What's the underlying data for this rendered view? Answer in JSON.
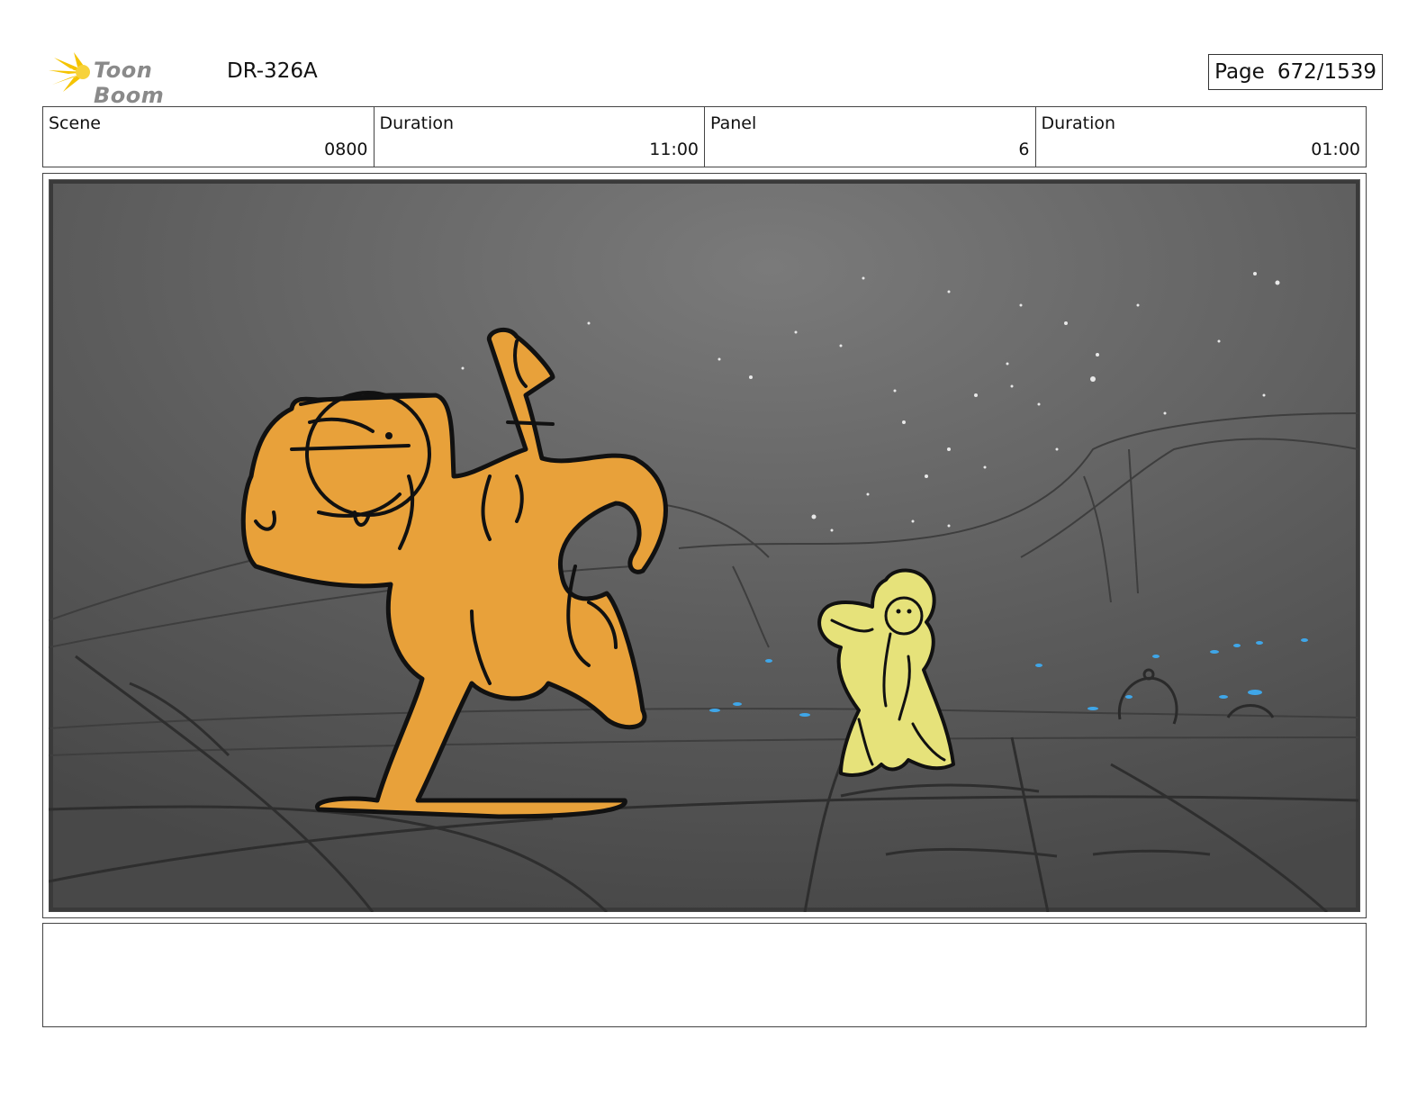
{
  "header": {
    "logo_text": "Toon Boom",
    "doc_id": "DR-326A",
    "page_label": "Page",
    "page_value": "672/1539"
  },
  "info": {
    "scene_label": "Scene",
    "scene_value": "0800",
    "scene_duration_label": "Duration",
    "scene_duration_value": "11:00",
    "panel_label": "Panel",
    "panel_value": "6",
    "panel_duration_label": "Duration",
    "panel_duration_value": "01:00"
  },
  "notes": {
    "text": ""
  },
  "colors": {
    "sky": "#5a5a5a",
    "orange_character": "#e8a13a",
    "yellow_character": "#e6e27a",
    "logo_yellow": "#f5c400",
    "crowd_blue": "#3fa6e8"
  },
  "icons": {
    "logo": "starburst-icon"
  }
}
